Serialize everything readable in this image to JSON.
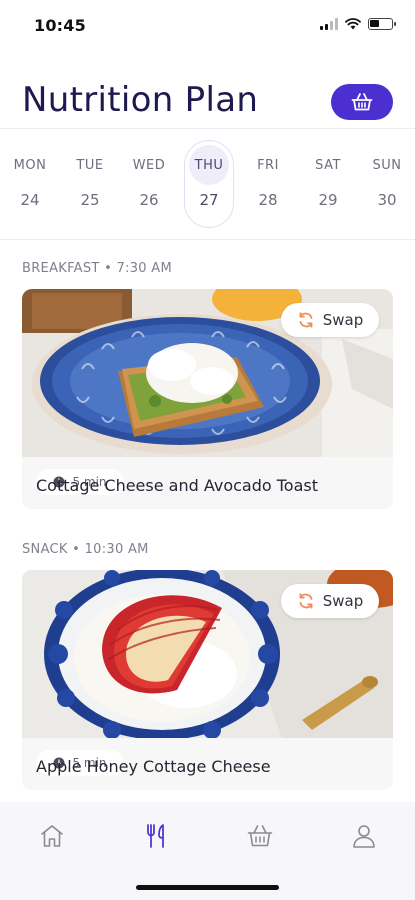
{
  "status": {
    "time": "10:45"
  },
  "header": {
    "title": "Nutrition Plan",
    "basket_icon": "basket-icon"
  },
  "week": [
    {
      "name": "MON",
      "date": "24",
      "selected": false
    },
    {
      "name": "TUE",
      "date": "25",
      "selected": false
    },
    {
      "name": "WED",
      "date": "26",
      "selected": false
    },
    {
      "name": "THU",
      "date": "27",
      "selected": true
    },
    {
      "name": "FRI",
      "date": "28",
      "selected": false
    },
    {
      "name": "SAT",
      "date": "29",
      "selected": false
    },
    {
      "name": "SUN",
      "date": "30",
      "selected": false
    }
  ],
  "meals": [
    {
      "label": "BREAKFAST • 7:30 AM",
      "title": "Cottage Cheese and Avocado Toast",
      "duration": "5 min",
      "swap_label": "Swap"
    },
    {
      "label": "SNACK • 10:30 AM",
      "title": "Apple Honey Cottage Cheese",
      "duration": "5 min",
      "swap_label": "Swap"
    }
  ],
  "tabs": [
    {
      "icon": "home-icon",
      "active": false
    },
    {
      "icon": "fork-knife-icon",
      "active": true
    },
    {
      "icon": "basket-icon",
      "active": false
    },
    {
      "icon": "profile-icon",
      "active": false
    }
  ],
  "colors": {
    "accent": "#4b2fd1",
    "title": "#1e1a4f",
    "swap_icon": "#f08c5a",
    "tab_inactive": "#8a8a96"
  }
}
